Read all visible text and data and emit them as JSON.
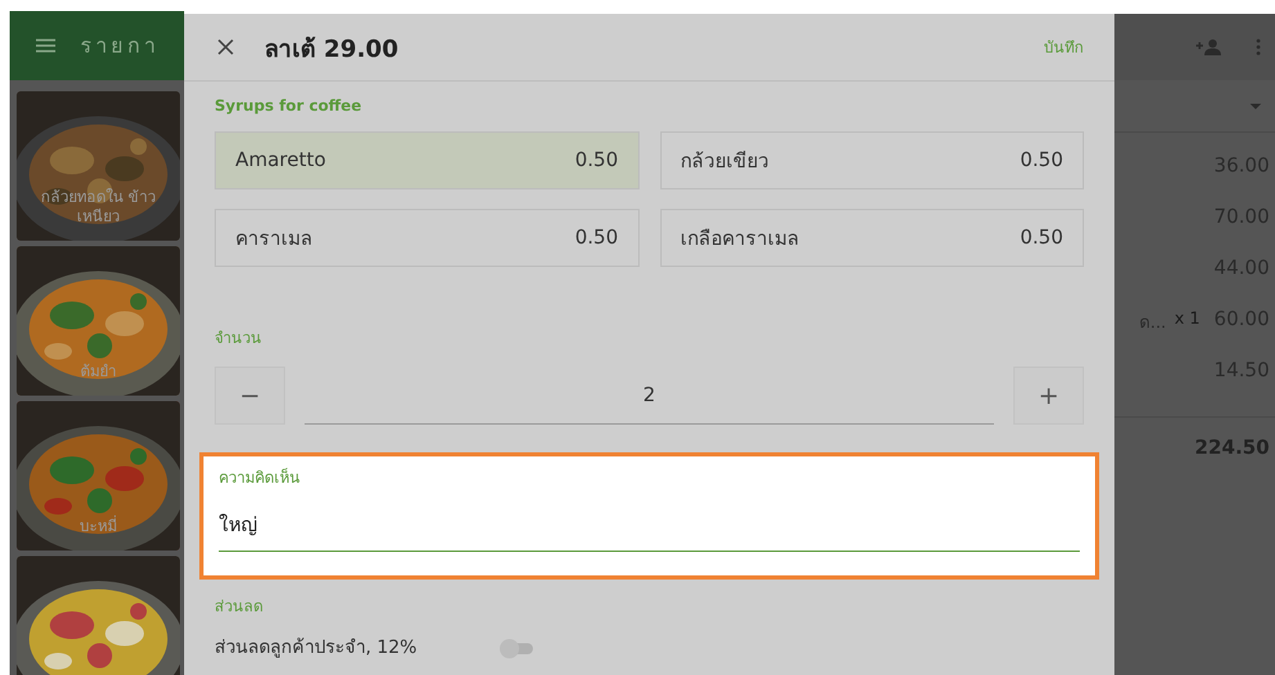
{
  "app_bar": {
    "title": "รายกา"
  },
  "menu_tiles": [
    {
      "name": "กล้วยทอดใน ข้าวเหนียว",
      "kind": "picture"
    },
    {
      "name": "ต้มยำ",
      "kind": "picture"
    },
    {
      "name": "บะหมี่",
      "kind": "picture"
    },
    {
      "kind": "picture"
    }
  ],
  "order": {
    "lines": [
      {
        "amount": "36.00"
      },
      {
        "amount": "70.00"
      },
      {
        "amount": "44.00"
      },
      {
        "name": "ด...",
        "quantity": "x 1",
        "amount": "60.00"
      },
      {
        "amount": "14.50"
      }
    ],
    "total": "224.50"
  },
  "dialog": {
    "title": "ลาเต้ 29.00",
    "save": "บันทึก",
    "modifier_group": {
      "title": "Syrups for coffee",
      "options": [
        {
          "name": "Amaretto",
          "price": "0.50",
          "selected": true
        },
        {
          "name": "กล้วยเขียว",
          "price": "0.50",
          "selected": false
        },
        {
          "name": "คาราเมล",
          "price": "0.50",
          "selected": false
        },
        {
          "name": "เกลือคาราเมล",
          "price": "0.50",
          "selected": false
        }
      ]
    },
    "quantity": {
      "label": "จำนวน",
      "minus": "−",
      "value": "2",
      "plus": "+"
    },
    "comment": {
      "label": "ความคิดเห็น",
      "value": "ใหญ่",
      "highlighted": true
    },
    "discount": {
      "label": "ส่วนลด",
      "items": [
        {
          "label": "ส่วนลดลูกค้าประจำ, 12%",
          "on": false
        }
      ]
    }
  }
}
